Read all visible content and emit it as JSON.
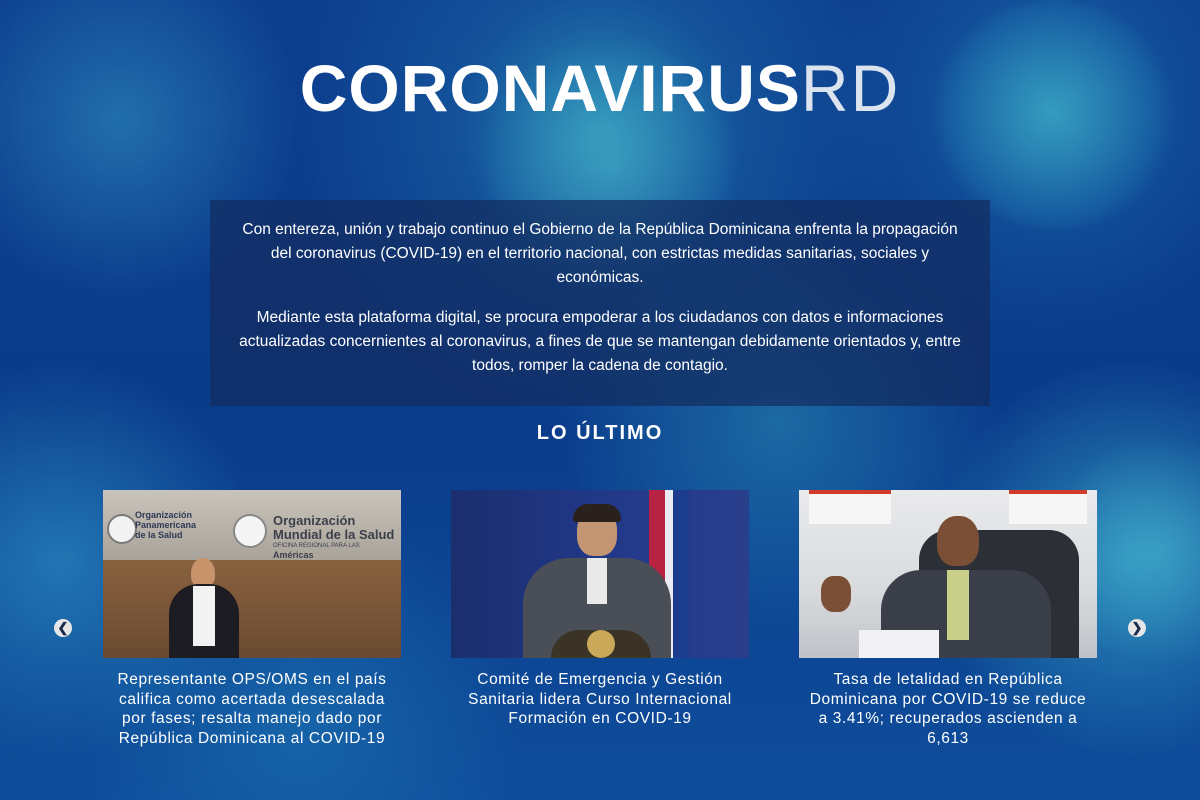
{
  "header": {
    "title_bold": "CORONAVIRUS",
    "title_light": "RD"
  },
  "intro": {
    "paragraph_1": "Con entereza, unión y trabajo continuo el Gobierno de la República Dominicana enfrenta la propagación del coronavirus (COVID-19) en el territorio nacional, con estrictas medidas sanitarias, sociales y económicas.",
    "paragraph_2": "Mediante esta plataforma digital, se procura empoderar a los ciudadanos con datos e informaciones actualizadas concernientes al coronavirus, a fines de que se mantengan debidamente orientados y, entre todos, romper la cadena de contagio."
  },
  "latest": {
    "title": "LO ÚLTIMO",
    "prev_icon": "chevron-left-icon",
    "next_icon": "chevron-right-icon",
    "items": [
      {
        "caption": "Representante OPS/OMS en el país califica como acertada desescalada por fases; resalta manejo dado por República Dominicana al COVID-19",
        "sign_line_1": "Organización",
        "sign_line_2": "Panamericana",
        "sign_line_3": "de la Salud",
        "sign_main_1": "Organización",
        "sign_main_2": "Mundial de la Salud",
        "sign_sub": "OFICINA REGIONAL PARA LAS",
        "sign_region": "Américas"
      },
      {
        "caption": "Comité de Emergencia y Gestión Sanitaria lidera Curso Internacional Formación en COVID-19"
      },
      {
        "caption": "Tasa de letalidad en República Dominicana por COVID-19 se reduce a 3.41%; recuperados ascienden a 6,613"
      }
    ]
  }
}
